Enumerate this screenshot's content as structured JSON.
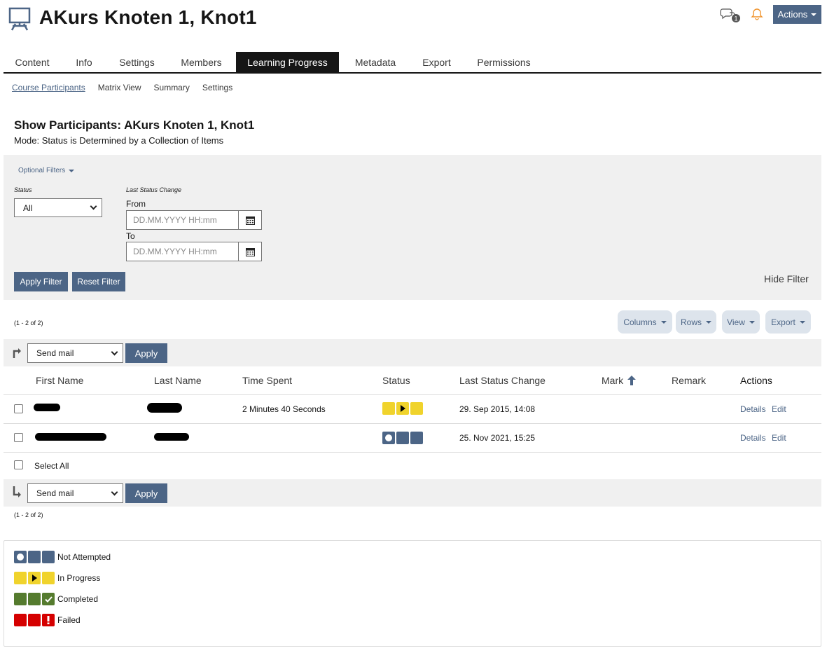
{
  "header": {
    "title": "AKurs Knoten 1, Knot1",
    "chat_badge": "1",
    "actions_label": "Actions"
  },
  "tabs": [
    {
      "label": "Content"
    },
    {
      "label": "Info"
    },
    {
      "label": "Settings"
    },
    {
      "label": "Members"
    },
    {
      "label": "Learning Progress",
      "active": true
    },
    {
      "label": "Metadata"
    },
    {
      "label": "Export"
    },
    {
      "label": "Permissions"
    }
  ],
  "subtabs": [
    {
      "label": "Course Participants",
      "active": true
    },
    {
      "label": "Matrix View"
    },
    {
      "label": "Summary"
    },
    {
      "label": "Settings"
    }
  ],
  "section": {
    "title": "Show Participants: AKurs Knoten 1, Knot1",
    "mode": "Mode: Status is Determined by a Collection of Items"
  },
  "filters": {
    "optional_filters_label": "Optional Filters",
    "status_label": "Status",
    "status_value": "All",
    "last_status_change_label": "Last Status Change",
    "from_label": "From",
    "to_label": "To",
    "date_placeholder": "DD.MM.YYYY HH:mm",
    "apply_label": "Apply Filter",
    "reset_label": "Reset Filter",
    "hide_label": "Hide Filter"
  },
  "table": {
    "count_top": "(1 - 2 of 2)",
    "count_bottom": "(1 - 2 of 2)",
    "view_controls": [
      {
        "label": "Columns"
      },
      {
        "label": "Rows"
      },
      {
        "label": "View"
      },
      {
        "label": "Export"
      }
    ],
    "command_select": "Send mail",
    "apply_label": "Apply",
    "columns": {
      "first_name": "First Name",
      "last_name": "Last Name",
      "time_spent": "Time Spent",
      "status": "Status",
      "last_status_change": "Last Status Change",
      "mark": "Mark",
      "remark": "Remark",
      "actions": "Actions"
    },
    "rows": [
      {
        "time_spent": "2 Minutes 40 Seconds",
        "status": "in-progress",
        "last_change": "29. Sep 2015, 14:08",
        "details": "Details",
        "edit": "Edit"
      },
      {
        "time_spent": "",
        "status": "not-attempted",
        "last_change": "25. Nov 2021, 15:25",
        "details": "Details",
        "edit": "Edit"
      }
    ],
    "select_all_label": "Select All"
  },
  "legend": [
    {
      "label": "Not Attempted",
      "color": "#4c6586"
    },
    {
      "label": "In Progress",
      "color": "#f0d32c"
    },
    {
      "label": "Completed",
      "color": "#557b2e"
    },
    {
      "label": "Failed",
      "color": "#d50000"
    }
  ]
}
